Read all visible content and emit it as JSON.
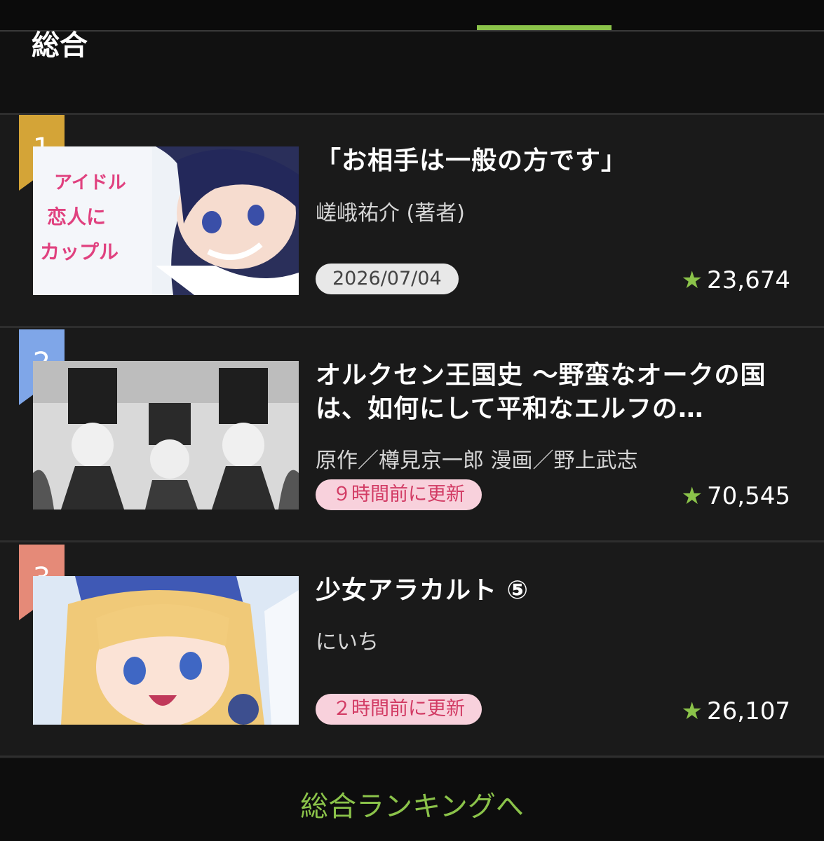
{
  "section": {
    "title": "総合"
  },
  "ranking": [
    {
      "rank": "1",
      "rank_color": "#d4a437",
      "title": "「お相手は一般の方です」",
      "author": "嵯峨祐介 (著者)",
      "badge": "2026/07/04",
      "badge_type": "date",
      "rating": "23,674"
    },
    {
      "rank": "2",
      "rank_color": "#7fa6e8",
      "title": "オルクセン王国史 〜野蛮なオークの国は、如何にして平和なエルフの…",
      "author": "原作／樽見京一郎 漫画／野上武志",
      "badge": "９時間前に更新",
      "badge_type": "update",
      "rating": "70,545"
    },
    {
      "rank": "3",
      "rank_color": "#e58a78",
      "title": "少女アラカルト ⑤",
      "author": "にいち",
      "badge": "２時間前に更新",
      "badge_type": "update",
      "rating": "26,107"
    }
  ],
  "footer": {
    "link_label": "総合ランキングへ"
  },
  "icons": {
    "rating": "star-icon"
  },
  "colors": {
    "accent": "#8bc34a",
    "badge_update_text": "#d23b64",
    "badge_update_bg": "#f8d1dc"
  }
}
